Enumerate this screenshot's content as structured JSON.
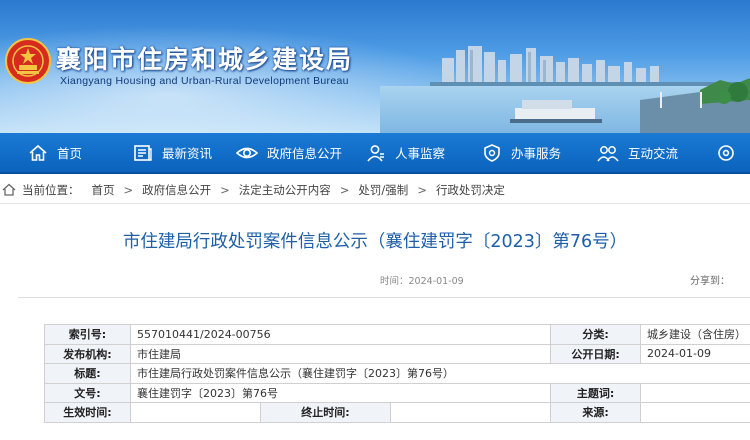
{
  "header": {
    "title": "襄阳市住房和城乡建设局",
    "subtitle": "Xiangyang Housing and Urban-Rural Development Bureau",
    "emblem_icon": "national-emblem-icon"
  },
  "nav": {
    "items": [
      {
        "label": "首页",
        "icon": "home-icon"
      },
      {
        "label": "最新资讯",
        "icon": "news-icon"
      },
      {
        "label": "政府信息公开",
        "icon": "eye-icon"
      },
      {
        "label": "人事监察",
        "icon": "person-icon"
      },
      {
        "label": "办事服务",
        "icon": "shield-icon"
      },
      {
        "label": "互动交流",
        "icon": "chat-icon"
      },
      {
        "label": "",
        "icon": "gear-icon"
      }
    ]
  },
  "breadcrumb": {
    "prefix": "当前位置：",
    "items": [
      "首页",
      "政府信息公开",
      "法定主动公开内容",
      "处罚/强制",
      "行政处罚决定"
    ],
    "separator": ">"
  },
  "article": {
    "title": "市住建局行政处罚案件信息公示（襄住建罚字〔2023〕第76号）",
    "time": "时间：2024-01-09",
    "share": "分享到："
  },
  "info": {
    "index_label": "索引号:",
    "index_value": "557010441/2024-00756",
    "category_label": "分类:",
    "category_value": "城乡建设（含住房）",
    "publisher_label": "发布机构:",
    "publisher_value": "市住建局",
    "pubdate_label": "公开日期:",
    "pubdate_value": "2024-01-09",
    "title_label": "标题:",
    "title_value": "市住建局行政处罚案件信息公示（襄住建罚字〔2023〕第76号）",
    "docno_label": "文号:",
    "docno_value": "襄住建罚字〔2023〕第76号",
    "subject_label": "主题词:",
    "subject_value": "",
    "effective_label": "生效时间:",
    "effective_value": "",
    "expire_label": "终止时间:",
    "expire_value": "",
    "source_label": "来源:",
    "source_value": ""
  },
  "colors": {
    "nav_bg": "#0b63bd",
    "title_blue": "#1e5fa8",
    "label_bg": "#f0f4f8"
  }
}
